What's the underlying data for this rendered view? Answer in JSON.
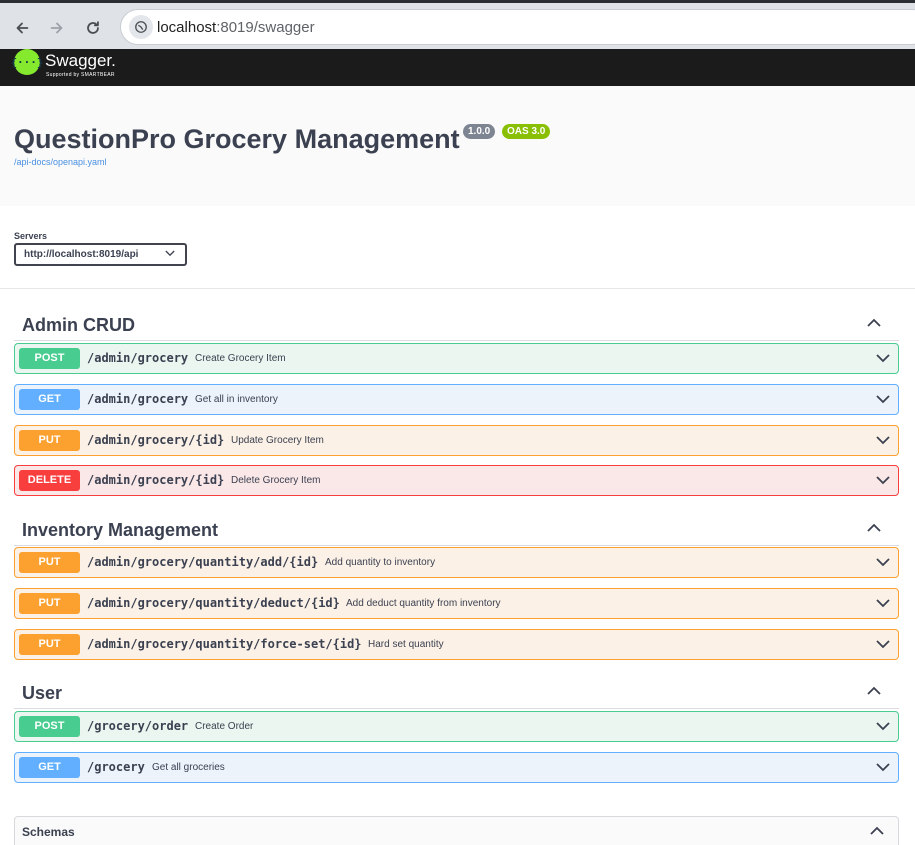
{
  "browser": {
    "url_host": "localhost",
    "url_rest": ":8019/swagger"
  },
  "topbar": {
    "logo_mark": "{···}",
    "logo_name": "Swagger.",
    "logo_sub": "Supported by SMARTBEAR"
  },
  "info": {
    "title": "QuestionPro Grocery Management",
    "version": "1.0.0",
    "oas": "OAS 3.0",
    "spec_link": "/api-docs/openapi.yaml"
  },
  "servers": {
    "label": "Servers",
    "selected": "http://localhost:8019/api"
  },
  "sections": [
    {
      "title": "Admin CRUD",
      "ops": [
        {
          "method": "POST",
          "path": "/admin/grocery",
          "summary": "Create Grocery Item"
        },
        {
          "method": "GET",
          "path": "/admin/grocery",
          "summary": "Get all in inventory"
        },
        {
          "method": "PUT",
          "path": "/admin/grocery/{id}",
          "summary": "Update Grocery Item"
        },
        {
          "method": "DELETE",
          "path": "/admin/grocery/{id}",
          "summary": "Delete Grocery Item"
        }
      ]
    },
    {
      "title": "Inventory Management",
      "ops": [
        {
          "method": "PUT",
          "path": "/admin/grocery/quantity/add/{id}",
          "summary": "Add quantity to inventory"
        },
        {
          "method": "PUT",
          "path": "/admin/grocery/quantity/deduct/{id}",
          "summary": "Add deduct quantity from inventory"
        },
        {
          "method": "PUT",
          "path": "/admin/grocery/quantity/force-set/{id}",
          "summary": "Hard set quantity"
        }
      ]
    },
    {
      "title": "User",
      "ops": [
        {
          "method": "POST",
          "path": "/grocery/order",
          "summary": "Create Order"
        },
        {
          "method": "GET",
          "path": "/grocery",
          "summary": "Get all groceries"
        }
      ]
    }
  ],
  "schemas": {
    "title": "Schemas"
  },
  "colors": {
    "post": "#49cc90",
    "get": "#61affe",
    "put": "#fca130",
    "delete": "#f93e3e",
    "logo": "#85ea2d"
  }
}
